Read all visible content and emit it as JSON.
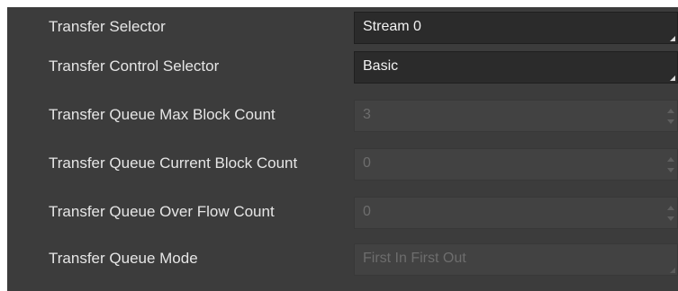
{
  "parameters": [
    {
      "label": "Transfer Selector",
      "value": "Stream 0",
      "control": "select",
      "enabled": true
    },
    {
      "label": "Transfer Control Selector",
      "value": "Basic",
      "control": "select",
      "enabled": true
    },
    {
      "label": "Transfer Queue Max Block Count",
      "value": "3",
      "control": "spinbox",
      "enabled": false
    },
    {
      "label": "Transfer Queue Current Block Count",
      "value": "0",
      "control": "spinbox",
      "enabled": false
    },
    {
      "label": "Transfer Queue Over Flow Count",
      "value": "0",
      "control": "spinbox",
      "enabled": false
    },
    {
      "label": "Transfer Queue Mode",
      "value": "First In First Out",
      "control": "select",
      "enabled": false
    }
  ],
  "colors": {
    "panel_background": "#3c3c3c",
    "active_field": "#2b2b2b",
    "disabled_field": "#424242",
    "label_text": "#e6e6e6",
    "disabled_text": "#6d6d6d"
  }
}
